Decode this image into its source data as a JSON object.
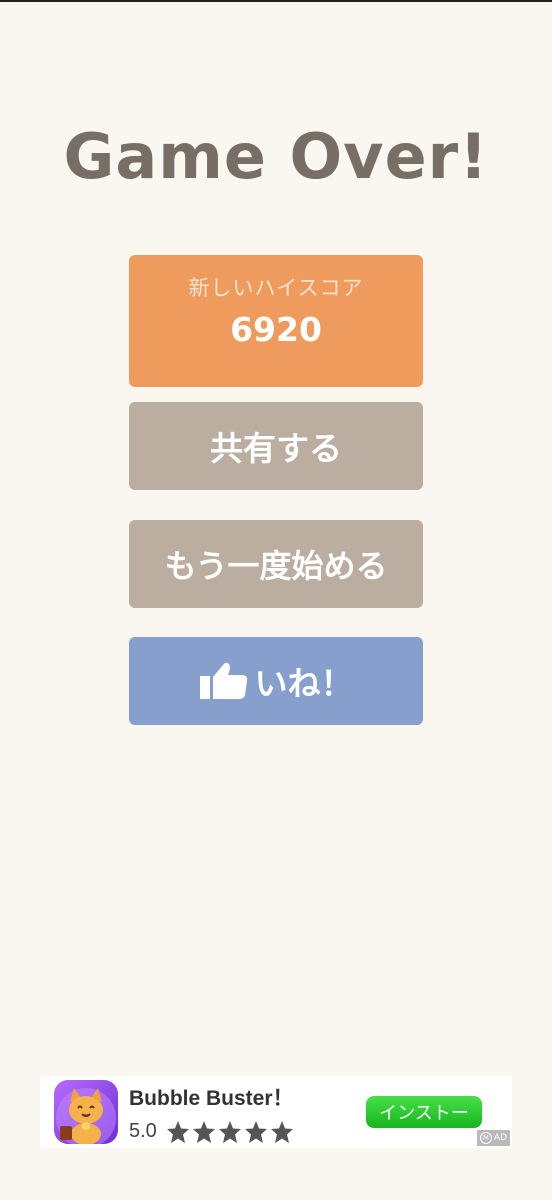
{
  "title": "Game Over!",
  "score": {
    "label": "新しいハイスコア",
    "value": "6920"
  },
  "buttons": {
    "share": "共有する",
    "restart": "もう一度始める",
    "like": "いね！"
  },
  "ad": {
    "app_name": "Bubble Buster！",
    "rating": "5.0",
    "stars": 5,
    "install_label": "インストー",
    "badge_text": "AD",
    "badge_icon": "M"
  },
  "colors": {
    "background": "#faf7f0",
    "score_card": "#ee9b5d",
    "neutral_button": "#bbada0",
    "like_button": "#869fcd",
    "title_text": "#776e65",
    "install_button": "#19b51f"
  },
  "icons": {
    "like": "thumbs-up-icon",
    "star": "star-icon",
    "ad_app": "cat-mascot-icon",
    "ad_badge": "ad-m-icon"
  }
}
